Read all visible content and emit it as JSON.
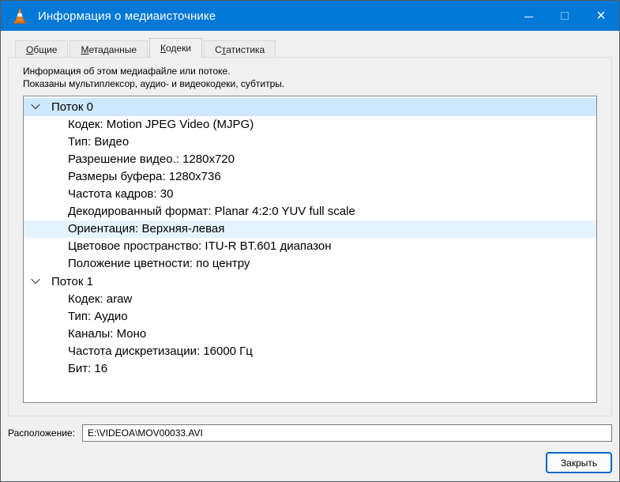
{
  "window": {
    "title": "Информация о медиаисточнике",
    "controls": {
      "minimize_glyph": "",
      "maximize_glyph": "",
      "close_glyph": "×"
    }
  },
  "tabs": {
    "items": [
      {
        "id": "general",
        "pre": "",
        "u": "О",
        "post": "бщие",
        "selected": false
      },
      {
        "id": "metadata",
        "pre": "",
        "u": "М",
        "post": "етаданные",
        "selected": false
      },
      {
        "id": "codec",
        "pre": "",
        "u": "К",
        "post": "одеки",
        "selected": true
      },
      {
        "id": "statistics",
        "pre": "С",
        "u": "т",
        "post": "атистика",
        "selected": false
      }
    ]
  },
  "info": {
    "line1": "Информация об этом медиафайле или потоке.",
    "line2": "Показаны мультиплексор, аудио- и видеокодеки, субтитры."
  },
  "tree": {
    "streams": [
      {
        "label": "Поток 0",
        "selected": true,
        "items": [
          {
            "text": "Кодек: Motion JPEG Video (MJPG)"
          },
          {
            "text": "Тип: Видео"
          },
          {
            "text": "Разрешение видео.: 1280x720"
          },
          {
            "text": "Размеры буфера: 1280x736"
          },
          {
            "text": "Частота кадров: 30"
          },
          {
            "text": "Декодированный формат: Planar 4:2:0 YUV full scale"
          },
          {
            "text": "Ориентация: Верхняя-левая",
            "highlighted": true
          },
          {
            "text": "Цветовое пространство: ITU-R BT.601 диапазон"
          },
          {
            "text": "Положение цветности: по центру"
          }
        ]
      },
      {
        "label": "Поток 1",
        "selected": false,
        "items": [
          {
            "text": "Кодек: araw"
          },
          {
            "text": "Тип: Аудио"
          },
          {
            "text": "Каналы: Моно"
          },
          {
            "text": "Частота дискретизации: 16000 Гц"
          },
          {
            "text": "Бит: 16"
          }
        ]
      }
    ]
  },
  "location": {
    "label": "Расположение:",
    "value": "E:\\VIDEOA\\MOV00033.AVI"
  },
  "buttons": {
    "close_label": "Закрыть"
  },
  "colors": {
    "titlebar": "#0078d7",
    "selection": "#cde8ff",
    "highlight": "#e5f3ff",
    "focus_border": "#0067c0"
  }
}
